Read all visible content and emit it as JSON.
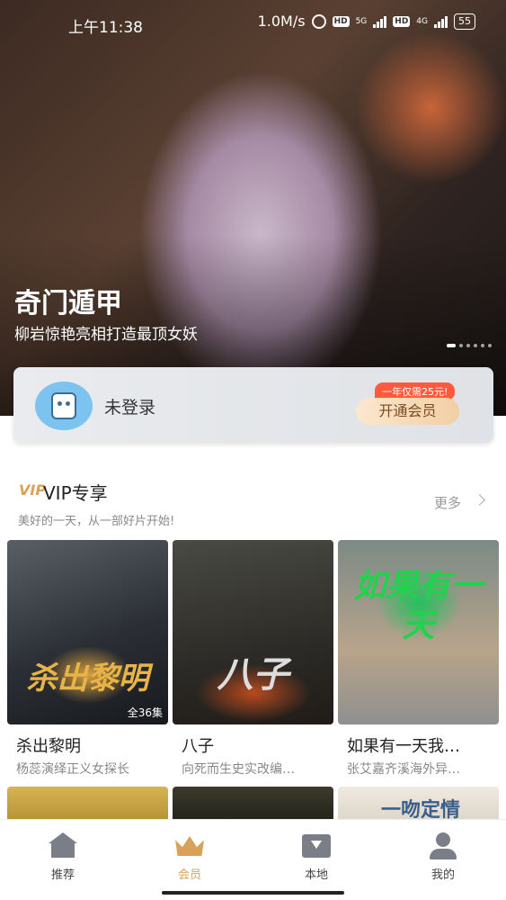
{
  "status_bar": {
    "time": "上午11:38",
    "speed": "1.0M/s",
    "hd1": "HD",
    "net1": "5G",
    "hd2": "HD",
    "net2": "4G",
    "battery": "55"
  },
  "banner": {
    "title": "奇门遁甲",
    "subtitle": "柳岩惊艳亮相打造最顶女妖",
    "slides": 6,
    "active_slide": 1
  },
  "login_card": {
    "status": "未登录",
    "promo": "一年仅需25元!",
    "button": "开通会员"
  },
  "section": {
    "icon_text": "VIP",
    "title": "VIP专享",
    "subtitle": "美好的一天，从一部好片开始!",
    "more": "更多"
  },
  "cards": [
    {
      "title": "杀出黎明",
      "desc": "杨蕊演绎正义女探长",
      "poster_text": "杀出黎明",
      "episodes": "全36集"
    },
    {
      "title": "八子",
      "desc": "向死而生史实改编…",
      "poster_text": "八子",
      "episodes": ""
    },
    {
      "title": "如果有一天我…",
      "desc": "张艾嘉齐溪海外异…",
      "poster_text": "如果有一天",
      "episodes": ""
    }
  ],
  "next_row": [
    {
      "poster_text": ""
    },
    {
      "poster_text": ""
    },
    {
      "poster_text": "一吻定情"
    }
  ],
  "nav": [
    {
      "label": "推荐",
      "icon": "home-icon"
    },
    {
      "label": "会员",
      "icon": "crown-icon",
      "active": true
    },
    {
      "label": "本地",
      "icon": "download-box-icon"
    },
    {
      "label": "我的",
      "icon": "user-icon"
    }
  ],
  "colors": {
    "accent": "#d4a45a",
    "promo": "#ff5a3c"
  }
}
